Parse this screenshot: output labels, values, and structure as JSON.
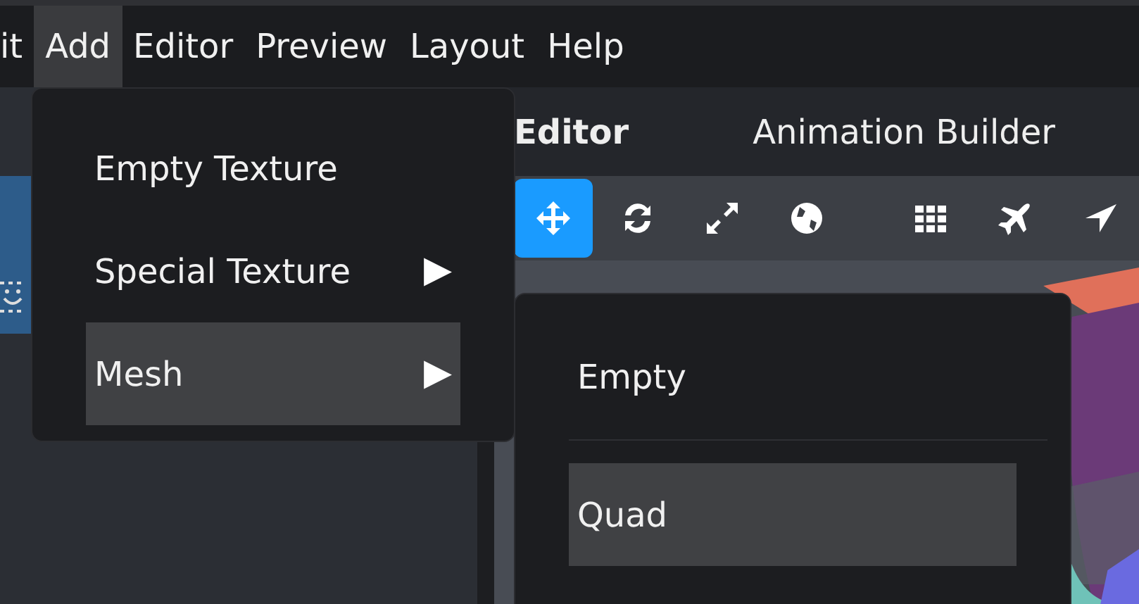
{
  "menubar": [
    {
      "label": "it",
      "selected": false
    },
    {
      "label": "Add",
      "selected": true
    },
    {
      "label": "Editor",
      "selected": false
    },
    {
      "label": "Preview",
      "selected": false
    },
    {
      "label": "Layout",
      "selected": false
    },
    {
      "label": "Help",
      "selected": false
    }
  ],
  "panel_tabs": [
    {
      "label": "Editor",
      "selected": true
    },
    {
      "label": "Animation Builder",
      "selected": false
    }
  ],
  "toolbar": [
    {
      "kind": "move",
      "selected": true
    },
    {
      "kind": "rotate",
      "selected": false
    },
    {
      "kind": "scale",
      "selected": false
    },
    {
      "kind": "globe",
      "selected": false
    },
    {
      "kind": "grid",
      "selected": false
    },
    {
      "kind": "plane",
      "selected": false
    },
    {
      "kind": "arrow",
      "selected": false
    }
  ],
  "menu": [
    {
      "label": "Empty Texture",
      "selected": false
    },
    {
      "label": "Special Texture",
      "arrow": "▶",
      "selected": false
    },
    {
      "label": "Mesh",
      "arrow": "▶",
      "selected": true
    }
  ],
  "submenu": [
    {
      "label": "Empty",
      "selected": false,
      "divider_after": true
    },
    {
      "label": "Quad",
      "selected": true,
      "divider_after": false
    }
  ]
}
